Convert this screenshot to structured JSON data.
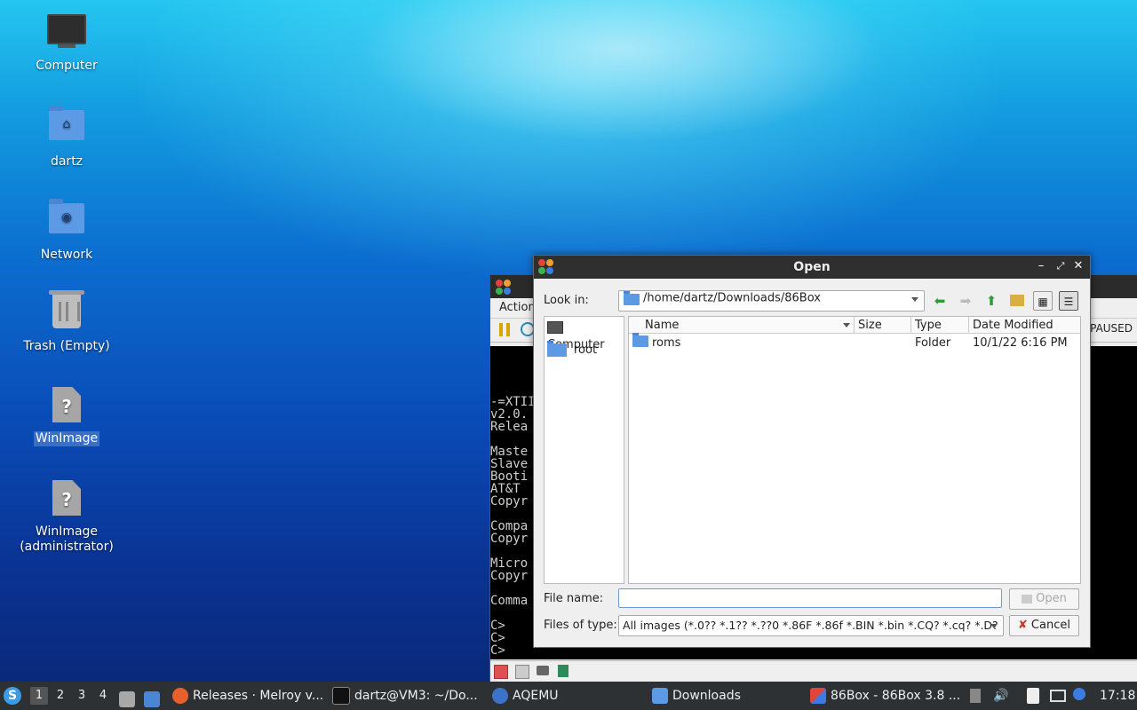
{
  "desktop": {
    "icons": [
      {
        "label": "Computer",
        "icon": "computer-icon"
      },
      {
        "label": "dartz",
        "icon": "home-folder-icon"
      },
      {
        "label": "Network",
        "icon": "network-folder-icon"
      },
      {
        "label": "Trash (Empty)",
        "icon": "trash-icon"
      },
      {
        "label": "WinImage",
        "icon": "unknown-file-icon",
        "selected": true
      },
      {
        "label": "WinImage\n(administrator)",
        "icon": "unknown-file-icon"
      }
    ]
  },
  "bg_window": {
    "menu_first": "Action",
    "status_paused": "PAUSED",
    "console_lines": [
      "",
      "",
      "",
      "",
      "-=XTII",
      "v2.0.",
      "Relea",
      "",
      "Maste",
      "Slave",
      "Booti",
      "AT&T ",
      "Copyr",
      "",
      "Compa",
      "Copyr",
      "",
      "Micro",
      "Copyr",
      "",
      "Comma",
      "",
      "C>",
      "C>",
      "C>"
    ]
  },
  "dialog": {
    "title": "Open",
    "look_in_label": "Look in:",
    "look_in_path": "/home/dartz/Downloads/86Box",
    "sidebar": [
      {
        "label": "Computer",
        "icon": "computer-icon"
      },
      {
        "label": "root",
        "icon": "folder-icon"
      }
    ],
    "columns": [
      "Name",
      "Size",
      "Type",
      "Date Modified"
    ],
    "rows": [
      {
        "name": "roms",
        "size": "",
        "type": "Folder",
        "date": "10/1/22 6:16 PM"
      }
    ],
    "file_name_label": "File name:",
    "file_name_value": "",
    "files_of_type_label": "Files of type:",
    "files_of_type_value": "All images (*.0?? *.1?? *.??0 *.86F *.86f *.BIN *.bin *.CQ? *.cq? *.D?",
    "open_button": "Open",
    "cancel_button": "Cancel"
  },
  "taskbar": {
    "workspaces": [
      "1",
      "2",
      "3",
      "4"
    ],
    "active_workspace": "1",
    "tasks": [
      {
        "label": "Releases · Melroy v...",
        "icon": "firefox-icon"
      },
      {
        "label": "dartz@VM3: ~/Do...",
        "icon": "terminal-icon"
      },
      {
        "label": "AQEMU",
        "icon": "aqemu-icon"
      },
      {
        "label": "Downloads",
        "icon": "folder-icon"
      },
      {
        "label": "86Box - 86Box 3.8 ...",
        "icon": "86box-icon"
      }
    ],
    "clock": "17:18"
  },
  "colors": {
    "accent_select": "#3a6fc7",
    "taskbar_bg": "#2d3134",
    "titlebar_bg": "#2f2f2f"
  }
}
